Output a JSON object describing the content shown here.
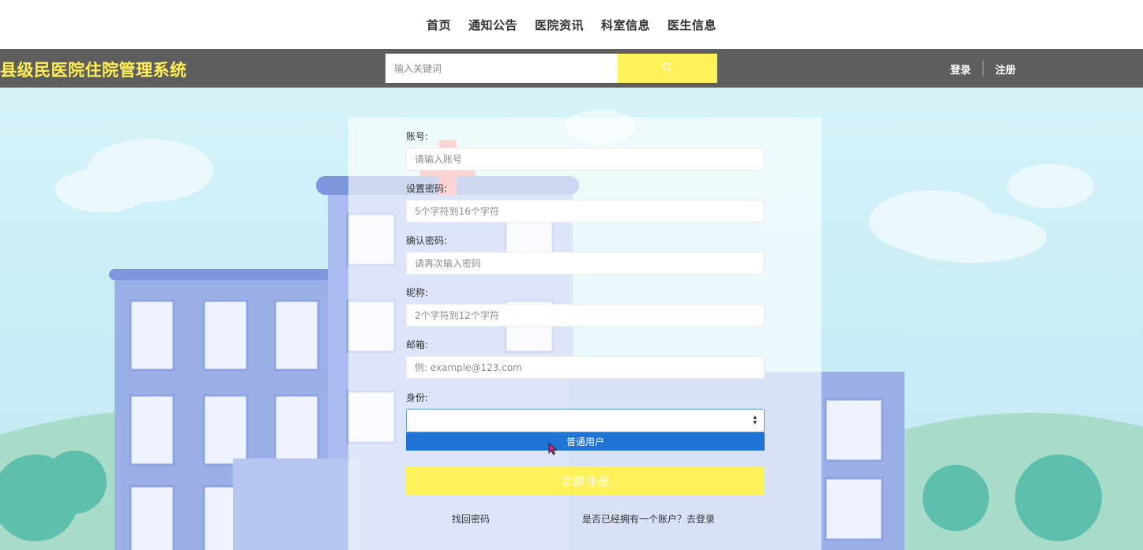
{
  "nav": {
    "items": [
      "首页",
      "通知公告",
      "医院资讯",
      "科室信息",
      "医生信息"
    ]
  },
  "header": {
    "title": "县级民医院住院管理系统",
    "search_placeholder": "输入关键词",
    "search_icon": "search-icon",
    "login": "登录",
    "register": "注册"
  },
  "form": {
    "account_label": "账号:",
    "account_placeholder": "请输入账号",
    "password_label": "设置密码:",
    "password_placeholder": "5个字符到16个字符",
    "confirm_label": "确认密码:",
    "confirm_placeholder": "请再次输入密码",
    "nickname_label": "昵称:",
    "nickname_placeholder": "2个字符到12个字符",
    "email_label": "邮箱:",
    "email_placeholder": "例: example@123.com",
    "identity_label": "身份:",
    "identity_value": "",
    "identity_option": "普通用户",
    "submit": "立即注册",
    "forgot": "找回密码",
    "has_account": "是否已经拥有一个账户？去登录"
  },
  "colors": {
    "accent": "#fff15a",
    "header_bg": "#5e5e5e",
    "title": "#ffee55",
    "option_bg": "#1f74d6"
  }
}
